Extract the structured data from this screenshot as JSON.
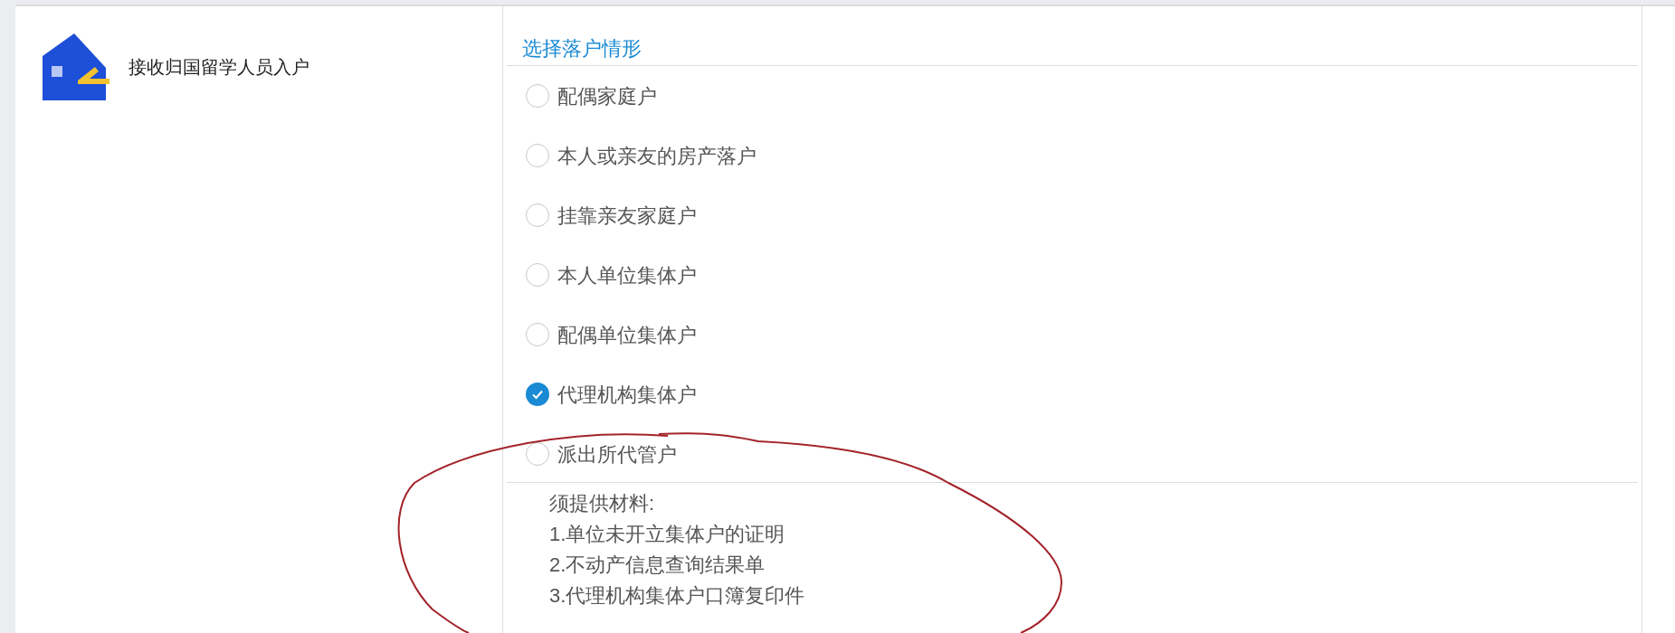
{
  "item": {
    "label": "接收归国留学人员入户"
  },
  "section": {
    "title": "选择落户情形",
    "options": [
      {
        "label": "配偶家庭户",
        "selected": false
      },
      {
        "label": "本人或亲友的房产落户",
        "selected": false
      },
      {
        "label": "挂靠亲友家庭户",
        "selected": false
      },
      {
        "label": "本人单位集体户",
        "selected": false
      },
      {
        "label": "配偶单位集体户",
        "selected": false
      },
      {
        "label": "代理机构集体户",
        "selected": true
      },
      {
        "label": "派出所代管户",
        "selected": false
      }
    ],
    "materials": [
      "须提供材料:",
      "1.单位未开立集体户的证明",
      "2.不动产信息查询结果单",
      "3.代理机构集体户口簿复印件"
    ]
  }
}
